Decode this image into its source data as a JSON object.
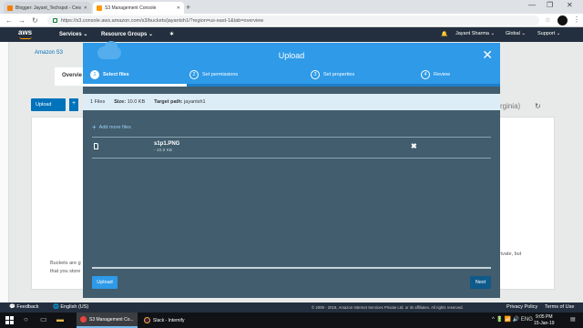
{
  "browser": {
    "tabs": [
      {
        "title": "Blogger: Jayant_Techspot - Creat",
        "active": false
      },
      {
        "title": "S3 Management Console",
        "active": true
      }
    ],
    "new_tab": "+",
    "url": "https://s3.console.aws.amazon.com/s3/buckets/jayantsh1/?region=us-east-1&tab=overview",
    "window_controls": {
      "minimize": "—",
      "maximize": "❐",
      "close": "✕"
    }
  },
  "aws_header": {
    "logo": "aws",
    "services": "Services ⌄",
    "resource_groups": "Resource Groups ⌄",
    "pin": "✶",
    "bell": "🔔",
    "user": "Jayant Sharma ⌄",
    "region": "Global ⌄",
    "support": "Support ⌄"
  },
  "background": {
    "breadcrumb": "Amazon S3",
    "overview_tab": "Overvie",
    "upload_button": "Upload",
    "plus_button": "+",
    "region_text": "Virginia)",
    "refresh": "↻",
    "body_text": "Buckets are gl... that you store...",
    "body_text_line1": "Buckets are g",
    "body_text_line2": "that you store",
    "side_text_line1": "S",
    "side_text_line2": "private, but",
    "side_text_line3": "c"
  },
  "modal": {
    "title": "Upload",
    "close": "✕",
    "steps": [
      {
        "num": "1",
        "label": "Select files",
        "current": true
      },
      {
        "num": "2",
        "label": "Set permissions",
        "current": false
      },
      {
        "num": "3",
        "label": "Set properties",
        "current": false
      },
      {
        "num": "4",
        "label": "Review",
        "current": false
      }
    ],
    "summary": {
      "files": "1 Files",
      "size_label": "Size:",
      "size_value": "10.0 KB",
      "target_label": "Target path:",
      "target_value": "jayantsh1"
    },
    "add_more": "Add more files",
    "file": {
      "name": "s1p1.PNG",
      "size": "- 10.0 KB",
      "remove": "✖"
    },
    "upload_button": "Upload",
    "next_button": "Next"
  },
  "footer": {
    "feedback": "Feedback",
    "language": "English (US)",
    "copyright": "© 2008 - 2019, Amazon Internet Services Private Ltd. or its affiliates. All rights reserved.",
    "privacy": "Privacy Policy",
    "terms": "Terms of Use"
  },
  "taskbar": {
    "apps": [
      {
        "label": "S3 Management Co...",
        "active": true,
        "color": "#e8453c"
      },
      {
        "label": "Slack - Internify",
        "active": false,
        "color": "#4a154b"
      }
    ],
    "time": "9:05 PM",
    "date": "15-Jan-19",
    "tray": "^ 🔋 📶 🔊 ENG"
  }
}
